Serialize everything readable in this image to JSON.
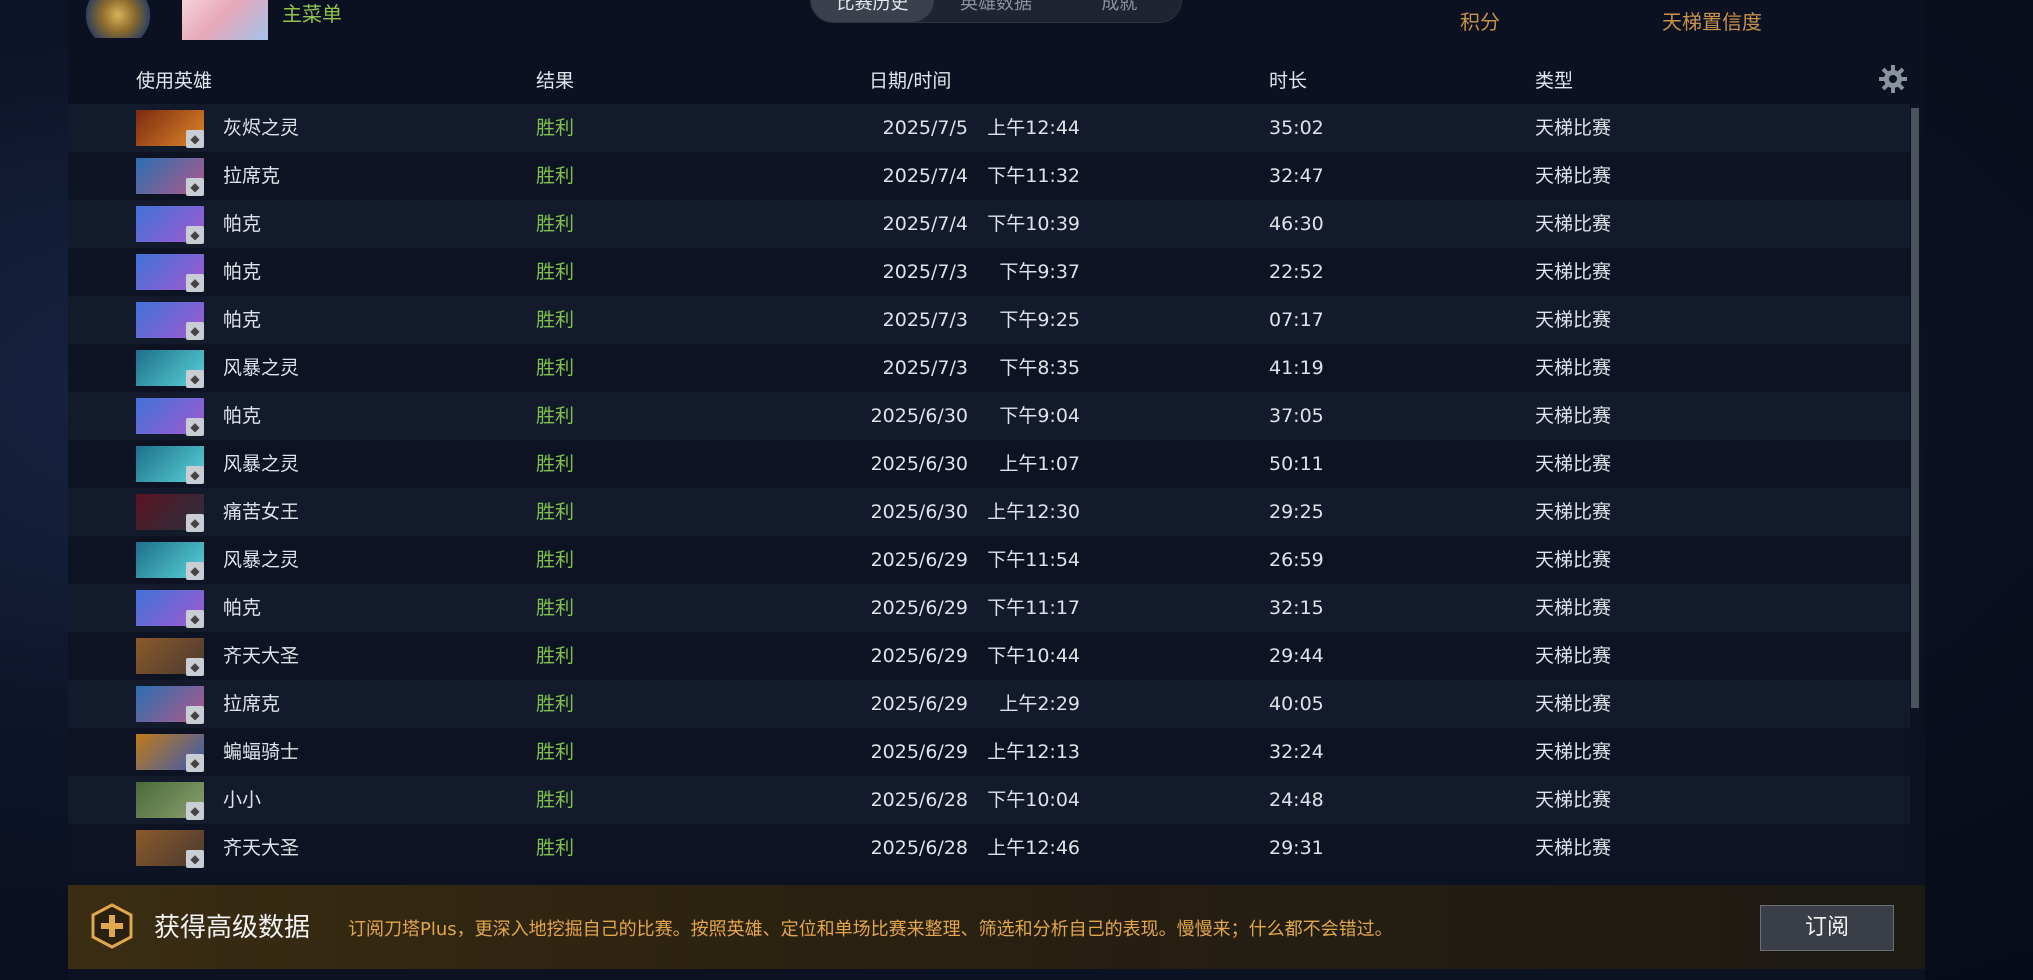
{
  "header": {
    "main_menu": "主菜单",
    "tabs": [
      {
        "label": "比赛历史",
        "active": true
      },
      {
        "label": "英雄数据",
        "active": false
      },
      {
        "label": "成就",
        "active": false
      }
    ],
    "right_labels": [
      "积分",
      "天梯置信度"
    ]
  },
  "table": {
    "columns": [
      "使用英雄",
      "结果",
      "日期/时间",
      "时长",
      "类型"
    ],
    "rows": [
      {
        "hero": "灰烬之灵",
        "result": "胜利",
        "date": "2025/7/5",
        "time": "上午12:44",
        "duration": "35:02",
        "type": "天梯比赛",
        "c1": "#7a2a10",
        "c2": "#e0872a"
      },
      {
        "hero": "拉席克",
        "result": "胜利",
        "date": "2025/7/4",
        "time": "下午11:32",
        "duration": "32:47",
        "type": "天梯比赛",
        "c1": "#2a6fb0",
        "c2": "#b05a8a"
      },
      {
        "hero": "帕克",
        "result": "胜利",
        "date": "2025/7/4",
        "time": "下午10:39",
        "duration": "46:30",
        "type": "天梯比赛",
        "c1": "#3f73d8",
        "c2": "#a25ad0"
      },
      {
        "hero": "帕克",
        "result": "胜利",
        "date": "2025/7/3",
        "time": "下午9:37",
        "duration": "22:52",
        "type": "天梯比赛",
        "c1": "#3f73d8",
        "c2": "#a25ad0"
      },
      {
        "hero": "帕克",
        "result": "胜利",
        "date": "2025/7/3",
        "time": "下午9:25",
        "duration": "07:17",
        "type": "天梯比赛",
        "c1": "#3f73d8",
        "c2": "#a25ad0"
      },
      {
        "hero": "风暴之灵",
        "result": "胜利",
        "date": "2025/7/3",
        "time": "下午8:35",
        "duration": "41:19",
        "type": "天梯比赛",
        "c1": "#1f6e8a",
        "c2": "#58d4d8"
      },
      {
        "hero": "帕克",
        "result": "胜利",
        "date": "2025/6/30",
        "time": "下午9:04",
        "duration": "37:05",
        "type": "天梯比赛",
        "c1": "#3f73d8",
        "c2": "#a25ad0"
      },
      {
        "hero": "风暴之灵",
        "result": "胜利",
        "date": "2025/6/30",
        "time": "上午1:07",
        "duration": "50:11",
        "type": "天梯比赛",
        "c1": "#1f6e8a",
        "c2": "#58d4d8"
      },
      {
        "hero": "痛苦女王",
        "result": "胜利",
        "date": "2025/6/30",
        "time": "上午12:30",
        "duration": "29:25",
        "type": "天梯比赛",
        "c1": "#5a1420",
        "c2": "#2a3040"
      },
      {
        "hero": "风暴之灵",
        "result": "胜利",
        "date": "2025/6/29",
        "time": "下午11:54",
        "duration": "26:59",
        "type": "天梯比赛",
        "c1": "#1f6e8a",
        "c2": "#58d4d8"
      },
      {
        "hero": "帕克",
        "result": "胜利",
        "date": "2025/6/29",
        "time": "下午11:17",
        "duration": "32:15",
        "type": "天梯比赛",
        "c1": "#3f73d8",
        "c2": "#a25ad0"
      },
      {
        "hero": "齐天大圣",
        "result": "胜利",
        "date": "2025/6/29",
        "time": "下午10:44",
        "duration": "29:44",
        "type": "天梯比赛",
        "c1": "#8a5a2a",
        "c2": "#4a3a30"
      },
      {
        "hero": "拉席克",
        "result": "胜利",
        "date": "2025/6/29",
        "time": "上午2:29",
        "duration": "40:05",
        "type": "天梯比赛",
        "c1": "#2a6fb0",
        "c2": "#b05a8a"
      },
      {
        "hero": "蝙蝠骑士",
        "result": "胜利",
        "date": "2025/6/29",
        "time": "上午12:13",
        "duration": "32:24",
        "type": "天梯比赛",
        "c1": "#c07a1a",
        "c2": "#3a5ab0"
      },
      {
        "hero": "小小",
        "result": "胜利",
        "date": "2025/6/28",
        "time": "下午10:04",
        "duration": "24:48",
        "type": "天梯比赛",
        "c1": "#4a6a3a",
        "c2": "#8aa070"
      },
      {
        "hero": "齐天大圣",
        "result": "胜利",
        "date": "2025/6/28",
        "time": "上午12:46",
        "duration": "29:31",
        "type": "天梯比赛",
        "c1": "#8a5a2a",
        "c2": "#4a3a30"
      }
    ]
  },
  "promo": {
    "title": "获得高级数据",
    "text": "订阅刀塔Plus，更深入地挖掘自己的比赛。按照英雄、定位和单场比赛来整理、筛选和分析自己的表现。慢慢来；什么都不会错过。",
    "button": "订阅",
    "accent": "#e2a64c"
  }
}
